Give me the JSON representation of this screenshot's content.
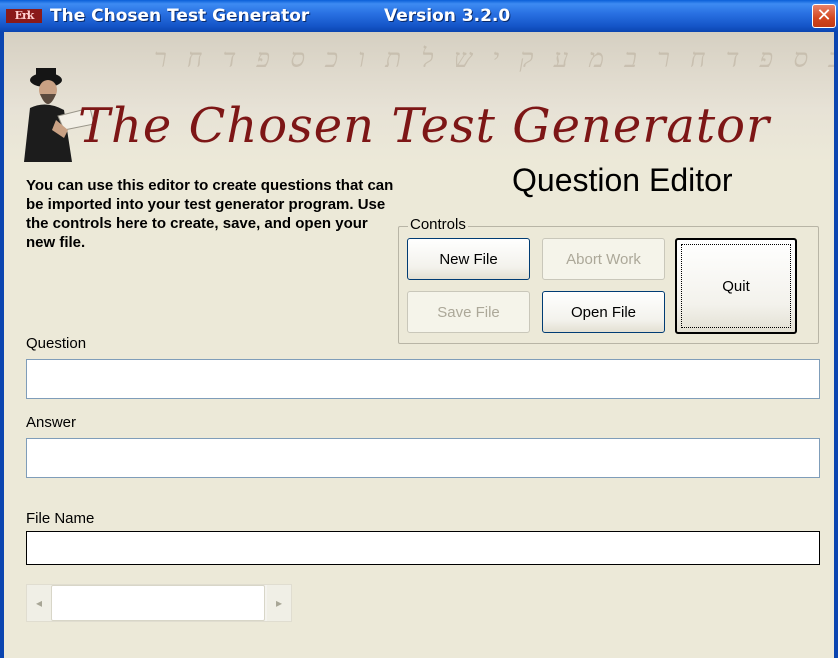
{
  "window": {
    "icon": "app-icon",
    "icon_text": "Erk",
    "title": "The Chosen Test Generator",
    "version": "Version 3.2.0",
    "close_glyph": "✕"
  },
  "banner": {
    "title": "The Chosen Test Generator",
    "background_script": "ש ל ת ו כ ס פ ד ח ר ב מ ע ק י ש ל ת ו כ ס פ ד ח ר"
  },
  "description": "You can use this editor to create questions that can be imported into your test generator program.  Use the controls here to create, save, and open your new file.",
  "heading": "Question Editor",
  "controls": {
    "label": "Controls",
    "new_file": "New File",
    "abort_work": "Abort Work",
    "save_file": "Save File",
    "open_file": "Open File",
    "quit": "Quit"
  },
  "fields": {
    "question_label": "Question",
    "question_value": "",
    "answer_label": "Answer",
    "answer_value": "",
    "filename_label": "File Name",
    "filename_value": ""
  },
  "scrollbar": {
    "left_icon": "arrow-left-icon",
    "right_icon": "arrow-right-icon"
  },
  "colors": {
    "titlebar": "#1556c9",
    "window_bg": "#ece9d8",
    "banner_title": "#7d1616",
    "button_border": "#003c74"
  }
}
